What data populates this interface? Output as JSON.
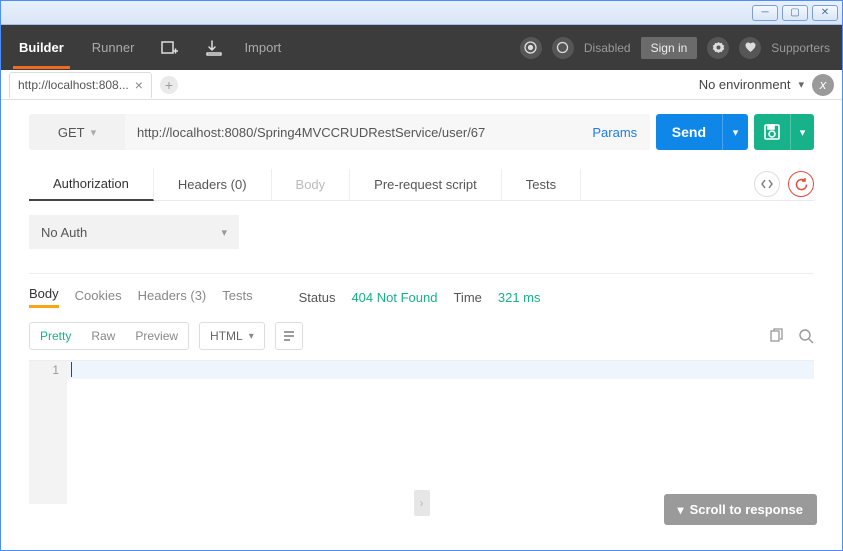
{
  "header": {
    "builder": "Builder",
    "runner": "Runner",
    "import": "Import",
    "disabled": "Disabled",
    "signin": "Sign in",
    "supporters": "Supporters"
  },
  "tabs": {
    "request_title": "http://localhost:808...",
    "environment": "No environment"
  },
  "request": {
    "method": "GET",
    "url": "http://localhost:8080/Spring4MVCCRUDRestService/user/67",
    "params": "Params",
    "send": "Send"
  },
  "reqtabs": {
    "auth": "Authorization",
    "headers": "Headers (0)",
    "body": "Body",
    "prerequest": "Pre-request script",
    "tests": "Tests"
  },
  "auth": {
    "selected": "No Auth"
  },
  "resptabs": {
    "body": "Body",
    "cookies": "Cookies",
    "headers": "Headers (3)",
    "tests": "Tests"
  },
  "response": {
    "status_label": "Status",
    "status_value": "404 Not Found",
    "time_label": "Time",
    "time_value": "321 ms"
  },
  "viewer": {
    "pretty": "Pretty",
    "raw": "Raw",
    "preview": "Preview",
    "format": "HTML",
    "line1": "1"
  },
  "scroll": "Scroll to response"
}
